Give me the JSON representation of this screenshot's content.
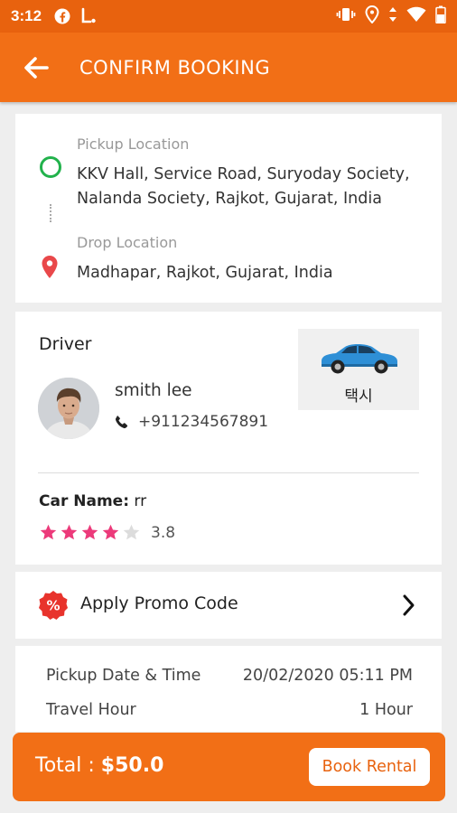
{
  "status_bar": {
    "time": "3:12"
  },
  "app_bar": {
    "title": "CONFIRM BOOKING"
  },
  "locations": {
    "pickup_label": "Pickup Location",
    "pickup_value": "KKV Hall, Service Road, Suryoday Society, Nalanda Society, Rajkot, Gujarat, India",
    "drop_label": "Drop Location",
    "drop_value": "Madhapar, Rajkot, Gujarat, India"
  },
  "driver": {
    "heading": "Driver",
    "name": "smith lee",
    "phone": "+911234567891",
    "car_type_label": "택시",
    "car_name_label": "Car Name:",
    "car_name_value": "rr",
    "rating": 3.8,
    "rating_text": "3.8",
    "stars_total": 5
  },
  "promo": {
    "label": "Apply Promo Code"
  },
  "details": {
    "rows": [
      {
        "label": "Pickup Date & Time",
        "value": "20/02/2020 05:11 PM"
      },
      {
        "label": "Travel Hour",
        "value": "1 Hour"
      }
    ]
  },
  "footer": {
    "total_label": "Total :",
    "total_value": "$50.0",
    "book_label": "Book Rental"
  },
  "colors": {
    "primary": "#f26f16",
    "status_bar": "#e8620e",
    "pickup_green": "#22b24c",
    "drop_red": "#e9484a",
    "star_pink": "#ec3a7a",
    "promo_red": "#e8332c"
  },
  "icons": {
    "back": "arrow-left-icon",
    "pickup": "circle-outline-icon",
    "drop": "map-pin-icon",
    "phone": "phone-icon",
    "car": "car-icon",
    "promo": "percent-badge-icon",
    "chevron": "chevron-right-icon"
  }
}
